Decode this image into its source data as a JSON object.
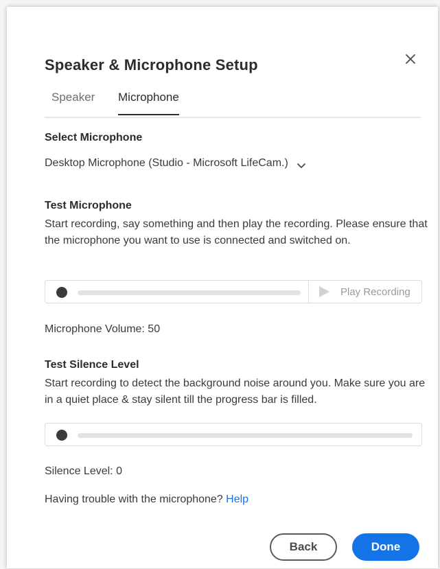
{
  "dialog": {
    "title": "Speaker & Microphone Setup",
    "close_icon": "close-icon"
  },
  "tabs": [
    {
      "label": "Speaker",
      "active": false
    },
    {
      "label": "Microphone",
      "active": true
    }
  ],
  "select_microphone": {
    "heading": "Select Microphone",
    "value": "Desktop Microphone (Studio - Microsoft LifeCam.)",
    "icon": "chevron-down-icon"
  },
  "test_microphone": {
    "heading": "Test Microphone",
    "description": "Start recording, say something and then play the recording. Please ensure that the microphone you want to use is connected and switched on.",
    "play_label": "Play Recording",
    "progress": 0,
    "volume_text": "Microphone Volume: 50"
  },
  "test_silence": {
    "heading": "Test Silence Level",
    "description": "Start recording to detect the background noise around you. Make sure you are in a quiet place & stay silent till the progress bar is filled.",
    "progress": 0,
    "level_text": "Silence Level: 0"
  },
  "help": {
    "text": "Having trouble with the microphone?",
    "link": "Help"
  },
  "buttons": {
    "back": "Back",
    "done": "Done"
  },
  "colors": {
    "accent": "#1473e6",
    "text": "#2c2c2c",
    "muted": "#9a9a9a"
  }
}
